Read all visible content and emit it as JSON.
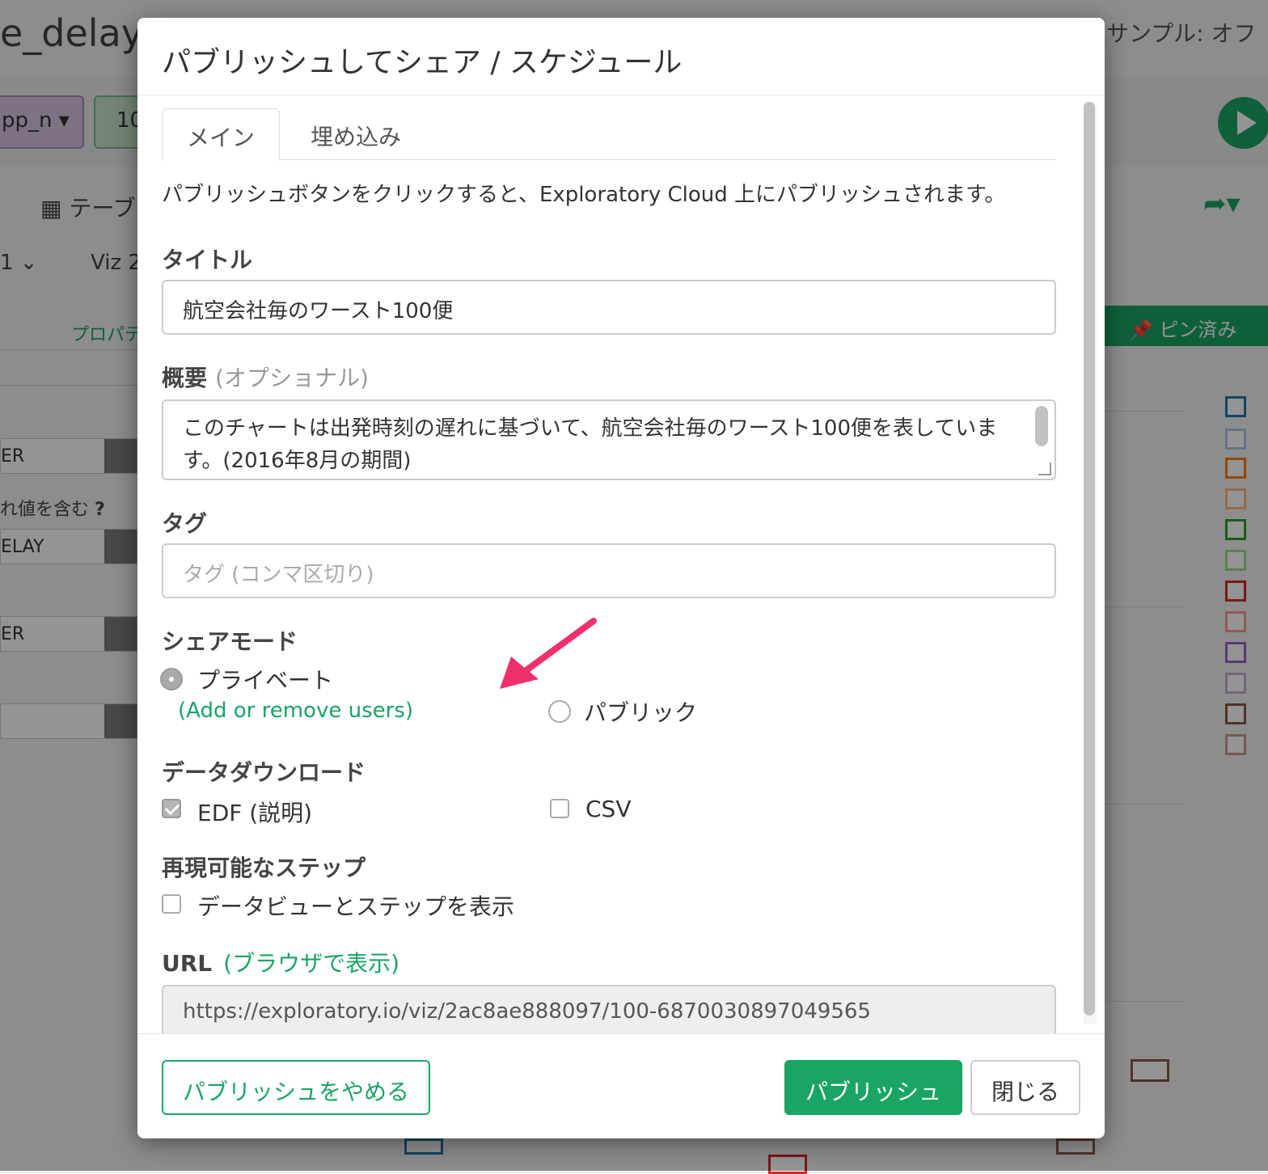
{
  "background": {
    "title": "e_delay_",
    "sample": "サンプル: オフ",
    "pill1": "pp_n ▾",
    "pill2": "10",
    "table_tab": "テーブ",
    "viz_tab": "Viz 2",
    "viz_dropdown": "1",
    "properties": "プロパテ",
    "pinned": "ピン済み",
    "row1": "ER",
    "row2_label": "れ値を含む",
    "row2": "ELAY",
    "row3": "ER"
  },
  "modal": {
    "title": "パブリッシュしてシェア / スケジュール",
    "tabs": [
      {
        "label": "メイン",
        "active": true
      },
      {
        "label": "埋め込み",
        "active": false
      }
    ],
    "intro": "パブリッシュボタンをクリックすると、Exploratory Cloud 上にパブリッシュされます。",
    "title_field": {
      "label": "タイトル",
      "value": "航空会社毎のワースト100便"
    },
    "summary_field": {
      "label": "概要",
      "optional": "(オプショナル)",
      "value": "このチャートは出発時刻の遅れに基づいて、航空会社毎のワースト100便を表しています。(2016年8月の期間)"
    },
    "tag_field": {
      "label": "タグ",
      "placeholder": "タグ (コンマ区切り)"
    },
    "share_mode": {
      "label": "シェアモード",
      "private": "プライベート",
      "private_link": "(Add or remove users)",
      "public": "パブリック",
      "selected": "private"
    },
    "download": {
      "label": "データダウンロード",
      "edf": "EDF (説明)",
      "edf_checked": true,
      "csv": "CSV",
      "csv_checked": false
    },
    "reproducible": {
      "label": "再現可能なステップ",
      "show_steps": "データビューとステップを表示",
      "checked": false
    },
    "url": {
      "label": "URL",
      "link": "(ブラウザで表示)",
      "value": "https://exploratory.io/viz/2ac8ae888097/100-6870030897049565"
    },
    "footer": {
      "unpublish": "パブリッシュをやめる",
      "publish": "パブリッシュ",
      "close": "閉じる"
    }
  },
  "colors": {
    "accent": "#1aa564",
    "annotation_arrow": "#f0306c"
  }
}
